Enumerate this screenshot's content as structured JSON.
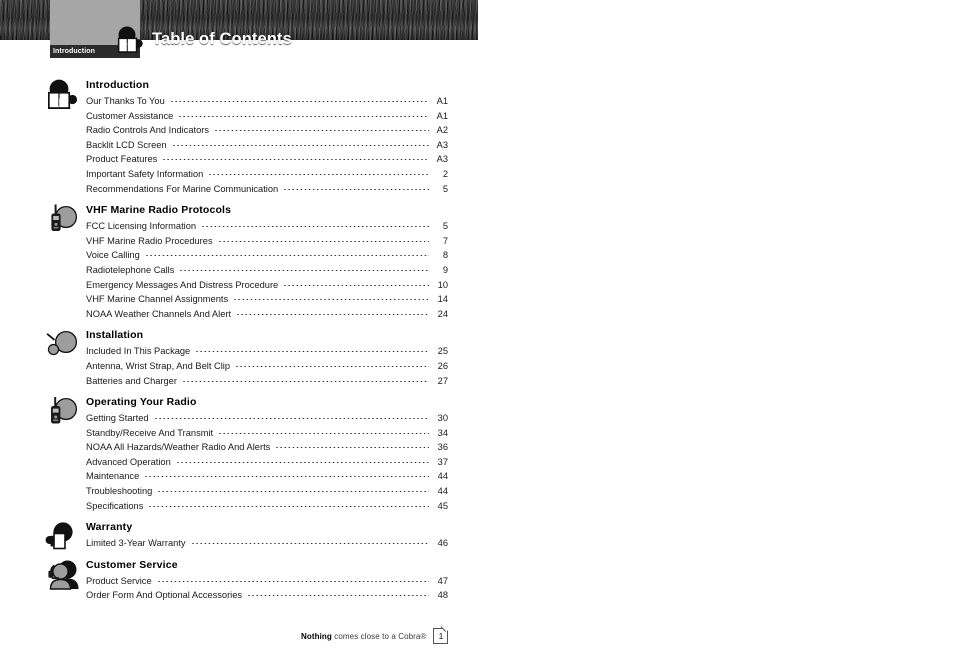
{
  "header": {
    "tab_label": "Introduction",
    "title": "Table of Contents",
    "icon": "open-book-icon",
    "band_color": "#2a2a2a",
    "tab_color": "#a6a6a6",
    "title_color": "#ffffff"
  },
  "sections": [
    {
      "title": "Introduction",
      "icon": "head-open-book-icon",
      "entries": [
        {
          "label": "Our Thanks To You",
          "page": "A1"
        },
        {
          "label": "Customer Assistance",
          "page": "A1"
        },
        {
          "label": "Radio Controls And Indicators",
          "page": "A2"
        },
        {
          "label": "Backlit LCD Screen",
          "page": "A3"
        },
        {
          "label": "Product Features",
          "page": "A3"
        },
        {
          "label": "Important Safety Information",
          "page": "2"
        },
        {
          "label": "Recommendations For Marine Communication",
          "page": "5"
        }
      ]
    },
    {
      "title": "VHF Marine Radio Protocols",
      "icon": "head-handheld-radio-icon",
      "entries": [
        {
          "label": "FCC Licensing Information",
          "page": "5"
        },
        {
          "label": "VHF Marine Radio Procedures",
          "page": "7"
        },
        {
          "label": "Voice Calling",
          "page": "8"
        },
        {
          "label": "Radiotelephone Calls",
          "page": "9"
        },
        {
          "label": "Emergency Messages And Distress Procedure",
          "page": "10"
        },
        {
          "label": "VHF Marine Channel Assignments",
          "page": "14"
        },
        {
          "label": "NOAA Weather Channels And Alert",
          "page": "24"
        }
      ]
    },
    {
      "title": "Installation",
      "icon": "head-antenna-icon",
      "entries": [
        {
          "label": "Included In This Package",
          "page": "25"
        },
        {
          "label": "Antenna, Wrist Strap, And Belt Clip",
          "page": "26"
        },
        {
          "label": "Batteries and Charger",
          "page": "27"
        }
      ]
    },
    {
      "title": "Operating Your Radio",
      "icon": "head-radio-operation-icon",
      "entries": [
        {
          "label": "Getting Started",
          "page": "30"
        },
        {
          "label": "Standby/Receive And Transmit",
          "page": "34"
        },
        {
          "label": "NOAA All Hazards/Weather Radio And Alerts",
          "page": "36"
        },
        {
          "label": "Advanced Operation",
          "page": "37"
        },
        {
          "label": "Maintenance",
          "page": "44"
        },
        {
          "label": "Troubleshooting",
          "page": "44"
        },
        {
          "label": "Specifications",
          "page": "45"
        }
      ]
    },
    {
      "title": "Warranty",
      "icon": "head-document-icon",
      "entries": [
        {
          "label": "Limited 3-Year Warranty",
          "page": "46"
        }
      ]
    },
    {
      "title": "Customer Service",
      "icon": "headset-person-icon",
      "entries": [
        {
          "label": "Product Service",
          "page": "47"
        },
        {
          "label": "Order Form And Optional Accessories",
          "page": "48"
        }
      ]
    }
  ],
  "footer": {
    "tagline_bold": "Nothing",
    "tagline_rest": " comes close to a Cobra®",
    "page_number": "1"
  }
}
